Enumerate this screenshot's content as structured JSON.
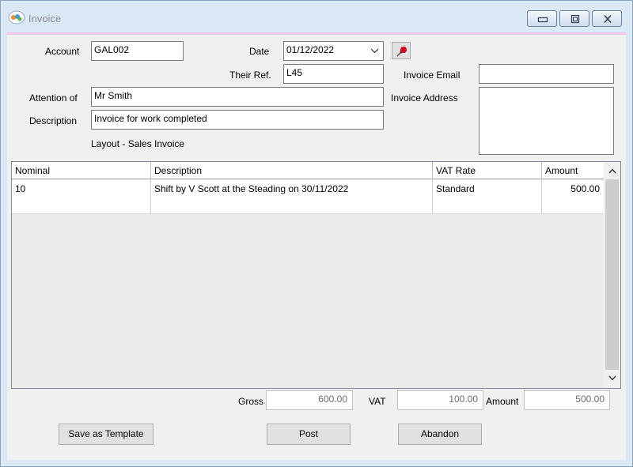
{
  "window": {
    "title": "Invoice"
  },
  "form": {
    "account_label": "Account",
    "account_value": "GAL002",
    "date_label": "Date",
    "date_value": "01/12/2022",
    "their_ref_label": "Their Ref.",
    "their_ref_value": "L45",
    "invoice_email_label": "Invoice Email",
    "invoice_email_value": "",
    "attention_label": "Attention of",
    "attention_value": "Mr Smith",
    "invoice_address_label": "Invoice Address",
    "invoice_address_value": "",
    "description_label": "Description",
    "description_value": "Invoice for work completed",
    "layout_text": "Layout - Sales Invoice"
  },
  "grid": {
    "columns": [
      "Nominal",
      "Description",
      "VAT Rate",
      "Amount"
    ],
    "rows": [
      {
        "nominal": "10",
        "description": "Shift by V Scott at the Steading on 30/11/2022",
        "vat_rate": "Standard",
        "amount": "500.00"
      }
    ]
  },
  "totals": {
    "gross_label": "Gross",
    "gross_value": "600.00",
    "vat_label": "VAT",
    "vat_value": "100.00",
    "amount_label": "Amount",
    "amount_value": "500.00"
  },
  "buttons": {
    "save_template": "Save as Template",
    "post": "Post",
    "abandon": "Abandon"
  },
  "icons": {
    "app": "invoice-app-icon",
    "minimize": "minimize-icon",
    "maximize": "maximize-icon",
    "close": "close-icon",
    "pin": "pushpin-icon",
    "date_dropdown": "chevron-down-icon"
  },
  "colors": {
    "window_frame": "#dbe8f5",
    "accent_line": "#f1c6e6",
    "pin_red": "#d6001c"
  }
}
